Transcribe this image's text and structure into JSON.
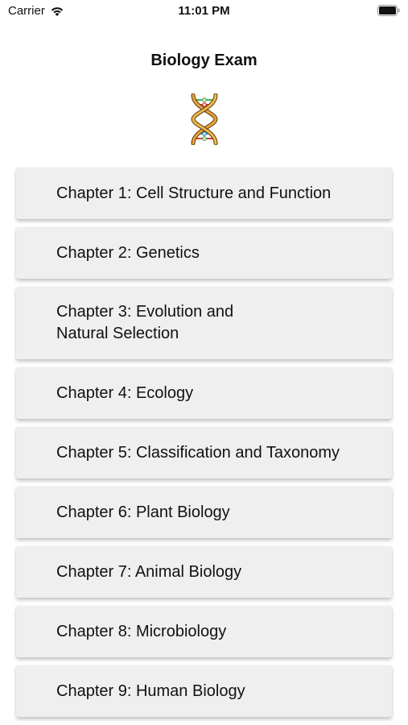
{
  "status_bar": {
    "carrier": "Carrier",
    "time": "11:01 PM"
  },
  "header": {
    "title": "Biology Exam",
    "icon": "dna-icon"
  },
  "chapters": [
    {
      "label": "Chapter 1: Cell Structure and Function"
    },
    {
      "label": "Chapter 2: Genetics"
    },
    {
      "label": "Chapter 3: Evolution and\nNatural Selection"
    },
    {
      "label": "Chapter 4: Ecology"
    },
    {
      "label": "Chapter 5: Classification and Taxonomy"
    },
    {
      "label": "Chapter 6: Plant Biology"
    },
    {
      "label": "Chapter 7: Animal Biology"
    },
    {
      "label": "Chapter 8: Microbiology"
    },
    {
      "label": "Chapter 9: Human Biology"
    }
  ],
  "colors": {
    "button_background": "#efefef",
    "text": "#111111",
    "dna_strand": "#e8a43a",
    "dna_rung_colors": [
      "#4caf50",
      "#e53935",
      "#1e88e5",
      "#8e24aa"
    ]
  }
}
